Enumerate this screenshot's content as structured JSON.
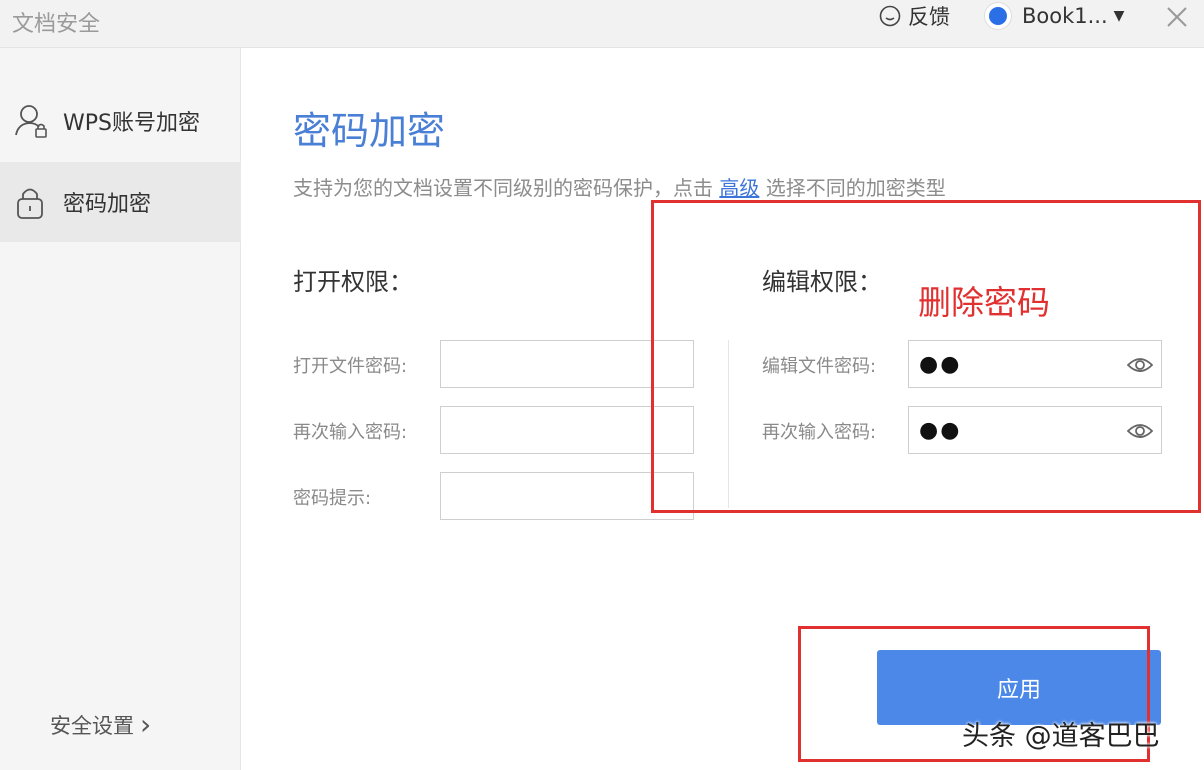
{
  "window": {
    "title": "文档安全",
    "feedback_label": "反馈",
    "account_name": "Book1...",
    "account_caret": "▼"
  },
  "sidebar": {
    "items": [
      {
        "label": "WPS账号加密",
        "icon": "user-lock-icon",
        "active": false
      },
      {
        "label": "密码加密",
        "icon": "lock-icon",
        "active": true
      }
    ],
    "footer_label": "安全设置",
    "footer_chevron": "›"
  },
  "main": {
    "title": "密码加密",
    "description_before": "支持为您的文档设置不同级别的密码保护，点击 ",
    "description_link": "高级",
    "description_after": " 选择不同的加密类型",
    "open_section": {
      "title": "打开权限：",
      "fields": [
        {
          "label": "打开文件密码:",
          "value": ""
        },
        {
          "label": "再次输入密码:",
          "value": ""
        },
        {
          "label": "密码提示:",
          "value": ""
        }
      ]
    },
    "edit_section": {
      "title": "编辑权限：",
      "fields": [
        {
          "label": "编辑文件密码:",
          "value": "●●"
        },
        {
          "label": "再次输入密码:",
          "value": "●●"
        }
      ]
    },
    "annotation": "删除密码",
    "apply_label": "应用"
  },
  "watermark": "头条 @道客巴巴",
  "colors": {
    "accent": "#4a7fd6",
    "button": "#4c88e8",
    "annotation_red": "#e03030"
  }
}
